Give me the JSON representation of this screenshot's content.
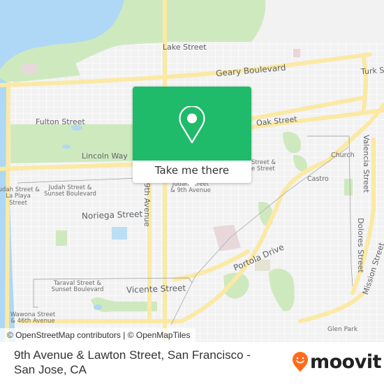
{
  "map": {
    "labels": {
      "lake_street": "Lake Street",
      "geary_boulevard": "Geary Boulevard",
      "turk_street": "Turk St",
      "fulton_street": "Fulton Street",
      "oak_street": "Oak Street",
      "lincoln_way": "Lincoln Way",
      "church": "Church",
      "castro": "Castro",
      "valencia_street": "Valencia Street",
      "dolores_street": "Dolores Street",
      "mission_street": "Mission Street",
      "judah_la_playa": "Judah Street & La Playa Street",
      "judah_sunset": "Judah Street & Sunset Boulevard",
      "noriega_street": "Noriega Street",
      "ninth_avenue": "9th Avenue",
      "ninth_avenue_stop": "Judah Street & 9th Avenue",
      "nearby_stop_right": "Street & e Street",
      "portola_drive": "Portola Drive",
      "taraval_sunset": "Taraval Street & Sunset Boulevard",
      "vicente_street": "Vicente Street",
      "wawona_46th": "Wawona Street & 46th Avenue",
      "glen_park": "Glen Park"
    },
    "colors": {
      "water": "#aed8f5",
      "park": "#cfe9bf",
      "land": "#f2f2f2",
      "major_road": "#fbe9a4",
      "street": "#ffffff"
    }
  },
  "popup": {
    "icon": "location-pin-icon",
    "cta_label": "Take me there",
    "color": "#1fba6a"
  },
  "attribution": {
    "osm": "© OpenStreetMap contributors",
    "separator": " | ",
    "omt": "© OpenMapTiles"
  },
  "footer": {
    "title": "9th Avenue & Lawton Street, San Francisco - San Jose, CA",
    "brand": "moovit",
    "brand_color": "#ff6b1a"
  }
}
